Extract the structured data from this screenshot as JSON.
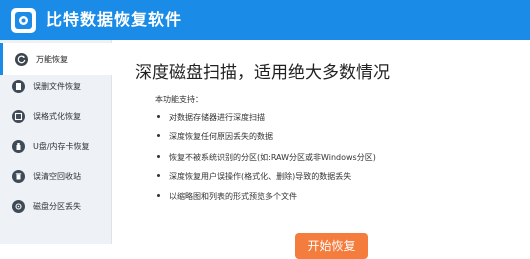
{
  "window": {
    "title": "比特数据恢复软件"
  },
  "sidebar": {
    "items": [
      {
        "label": "万能恢复",
        "icon": "refresh-icon",
        "active": true
      },
      {
        "label": "误删文件恢复",
        "icon": "file-icon",
        "active": false
      },
      {
        "label": "误格式化恢复",
        "icon": "format-icon",
        "active": false
      },
      {
        "label": "U盘/内存卡恢复",
        "icon": "usb-drive-icon",
        "active": false
      },
      {
        "label": "误清空回收站",
        "icon": "recycle-bin-icon",
        "active": false
      },
      {
        "label": "磁盘分区丢失",
        "icon": "disk-partition-icon",
        "active": false
      }
    ]
  },
  "main": {
    "title": "深度磁盘扫描，适用绝大多数情况",
    "features_label": "本功能支持：",
    "features": [
      "对数据存储器进行深度扫描",
      "深度恢复任何原因丢失的数据",
      "恢复不被系统识别的分区(如:RAW分区或非Windows分区)",
      "深度恢复用户误操作(格式化、删除)导致的数据丢失",
      "以缩略图和列表的形式预览多个文件"
    ],
    "start_button": "开始恢复"
  },
  "colors": {
    "accent": "#1a8be6",
    "button": "#f47c3c",
    "sidebar_bg": "#eef1f5"
  }
}
